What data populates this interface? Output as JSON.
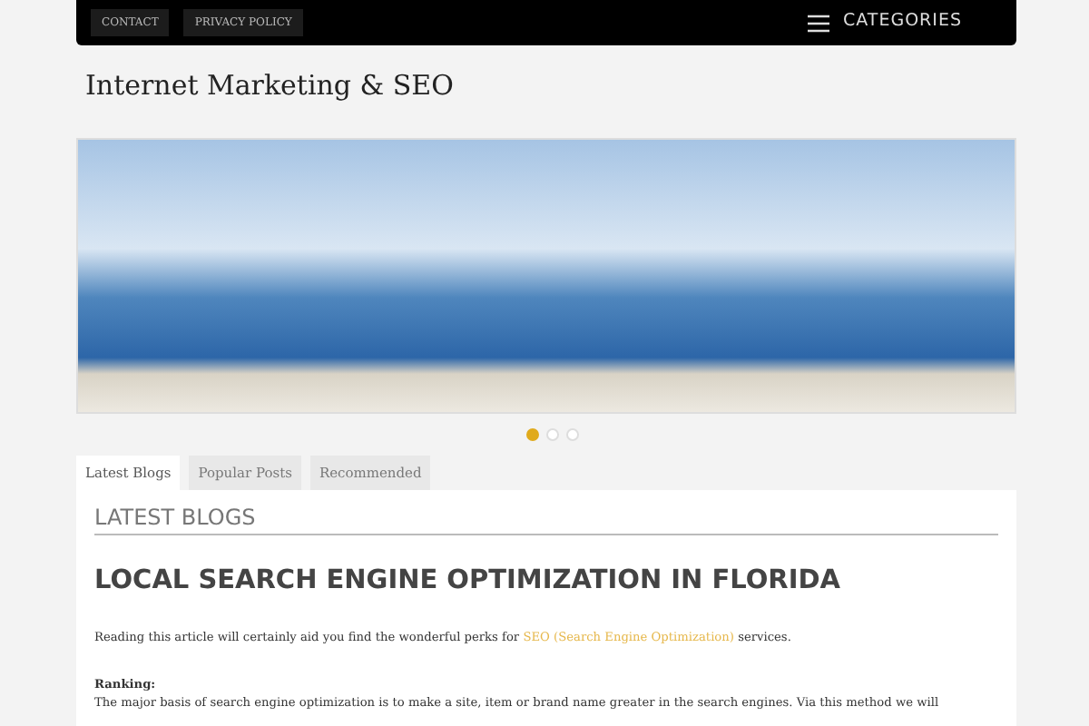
{
  "top_links": [
    {
      "label": "CONTACT"
    },
    {
      "label": "PRIVACY POLICY"
    }
  ],
  "categories_menu": {
    "label": "CATEGORIES"
  },
  "site_title": "Internet Marketing & SEO",
  "slider": {
    "dots": [
      {
        "selected": true
      },
      {
        "selected": false
      },
      {
        "selected": false
      }
    ]
  },
  "tabs": [
    {
      "label": "Latest Blogs",
      "selected": true
    },
    {
      "label": "Popular Posts",
      "selected": false
    },
    {
      "label": "Recommended",
      "selected": false
    }
  ],
  "section_heading": "LATEST BLOGS",
  "post": {
    "title": "LOCAL SEARCH ENGINE OPTIMIZATION IN FLORIDA",
    "intro_before": "Reading this article will certainly aid you find the wonderful perks for",
    "intro_link": "SEO (Search Engine Optimization)",
    "intro_after": "services.",
    "subheading": "Ranking:",
    "body": "The major basis of search engine optimization is to make a site, item or brand name greater in the search engines. Via this method we will"
  }
}
